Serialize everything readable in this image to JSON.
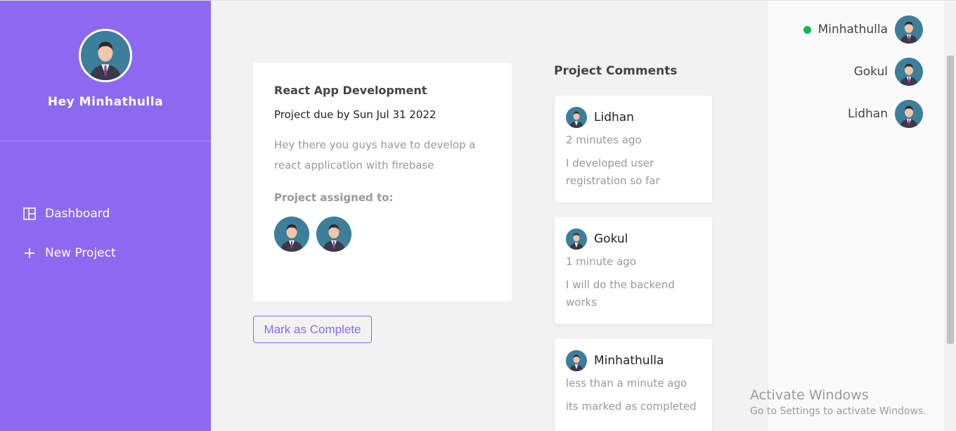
{
  "sidebar": {
    "greeting": "Hey Minhathulla",
    "nav": [
      {
        "label": "Dashboard",
        "icon": "dashboard-icon"
      },
      {
        "label": "New Project",
        "icon": "plus-icon"
      }
    ]
  },
  "project": {
    "title": "React App Development",
    "due": "Project due by Sun Jul 31 2022",
    "details": "Hey there you guys have to develop a react application with firebase",
    "assigned_label": "Project assigned to:",
    "complete_button": "Mark as Complete"
  },
  "comments": {
    "title": "Project Comments",
    "items": [
      {
        "name": "Lidhan",
        "time": "2 minutes ago",
        "text": "I developed user registration so far"
      },
      {
        "name": "Gokul",
        "time": "1 minute ago",
        "text": "I will do the backend works"
      },
      {
        "name": "Minhathulla",
        "time": "less than a minute ago",
        "text": "its marked as completed"
      }
    ]
  },
  "online_users": [
    {
      "name": "Minhathulla",
      "online": true
    },
    {
      "name": "Gokul",
      "online": false
    },
    {
      "name": "Lidhan",
      "online": false
    }
  ],
  "watermark": {
    "line1": "Activate Windows",
    "line2": "Go to Settings to activate Windows."
  },
  "colors": {
    "accent": "#8d69f1",
    "online": "#0ebb50"
  }
}
